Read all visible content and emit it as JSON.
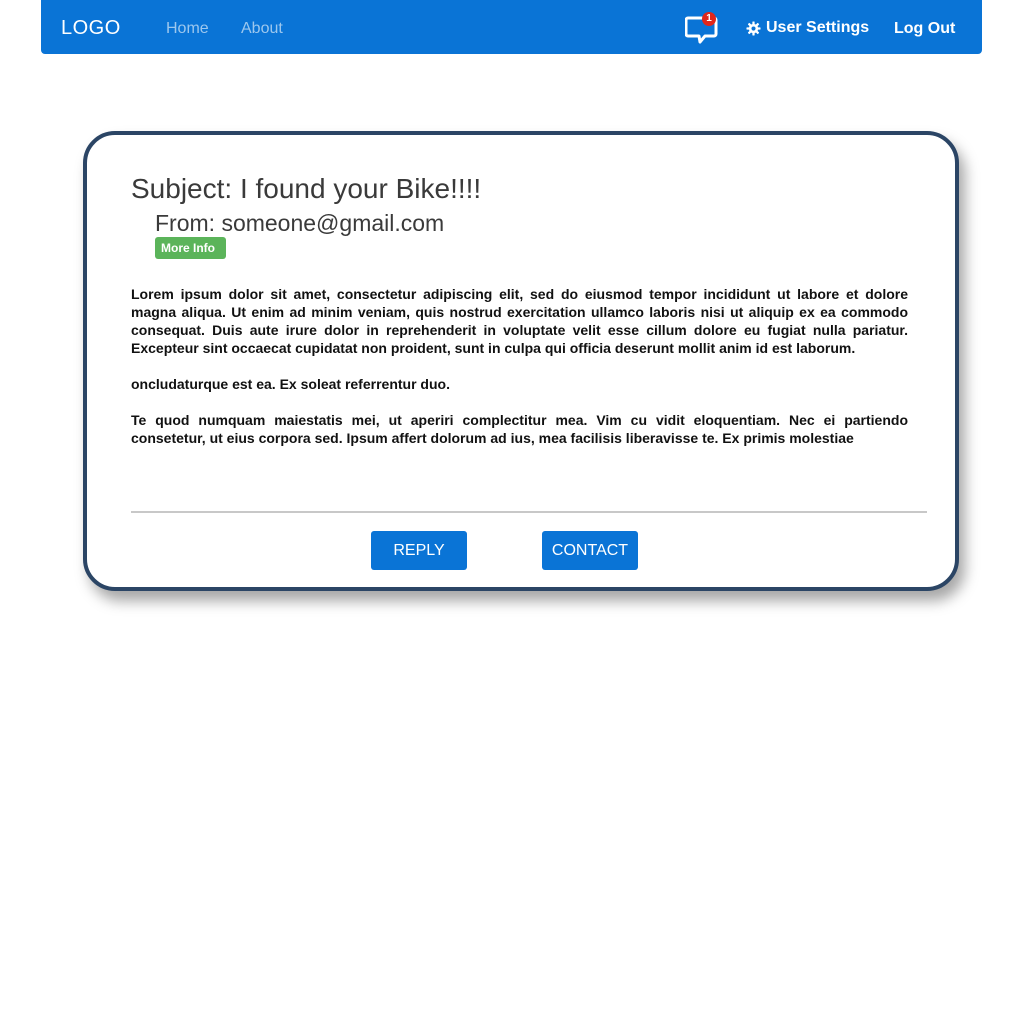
{
  "navbar": {
    "logo": "LOGO",
    "links": [
      {
        "label": "Home"
      },
      {
        "label": "About"
      }
    ],
    "notifications": {
      "count": "1",
      "icon": "chat-bubble-icon"
    },
    "settings": {
      "label": "User Settings",
      "icon": "gear-icon"
    },
    "logout_label": "Log Out",
    "colors": {
      "bar": "#0a74d6",
      "badge": "#e0261b"
    }
  },
  "message": {
    "subject": "Subject: I found your Bike!!!!",
    "from": "From: someone@gmail.com",
    "more_info_label": "More Info",
    "paragraphs": [
      "Lorem ipsum dolor sit amet, consectetur adipiscing elit, sed do eiusmod tempor incididunt ut labore et dolore magna aliqua. Ut enim ad minim veniam, quis nostrud exercitation ullamco laboris nisi ut aliquip ex ea commodo consequat. Duis aute irure dolor in reprehenderit in voluptate velit esse cillum dolore eu fugiat nulla pariatur. Excepteur sint occaecat cupidatat non proident, sunt in culpa qui officia deserunt mollit anim id est laborum.",
      "oncludaturque est ea. Ex soleat referrentur duo.",
      "Te quod numquam maiestatis mei, ut aperiri complectitur mea. Vim cu vidit eloquentiam. Nec ei partiendo consetetur, ut eius corpora sed. Ipsum affert dolorum ad ius, mea facilisis liberavisse te. Ex primis molestiae"
    ],
    "reply_label": "REPLY",
    "contact_label": "CONTACT",
    "colors": {
      "border": "#2b4565",
      "more_info": "#5bb45a",
      "button": "#0a74d6"
    }
  }
}
